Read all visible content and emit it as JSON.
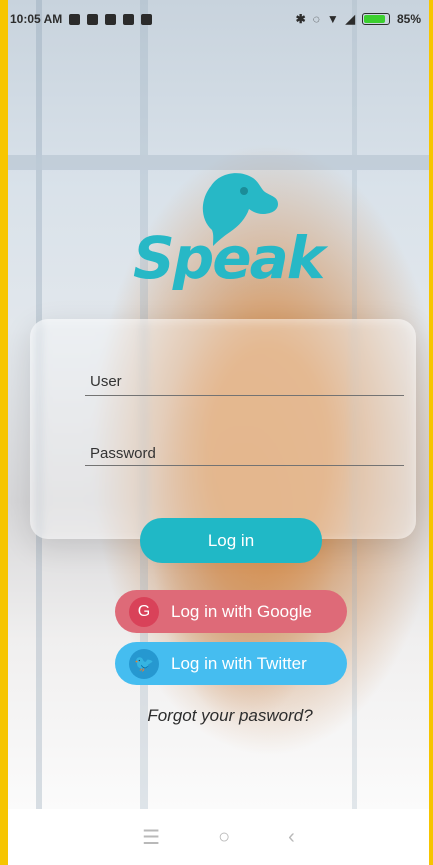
{
  "status": {
    "time": "10:05 AM",
    "left_icons": [
      "screenshot-icon",
      "facebook-icon",
      "linkedin-icon",
      "camera-icon",
      "briefcase-icon"
    ],
    "right_icons": [
      "bluetooth-icon",
      "sync-icon",
      "wifi-icon",
      "signal-icon",
      "battery-icon"
    ],
    "battery": "85%"
  },
  "app": {
    "name": "Speak",
    "brand_color": "#27b8c6"
  },
  "form": {
    "user_placeholder": "User",
    "password_placeholder": "Password"
  },
  "actions": {
    "login": "Log in",
    "google": "Log in with Google",
    "twitter": "Log in with Twitter",
    "forgot": "Forgot your pasword?"
  },
  "navbar": {
    "menu": "☰",
    "home": "○",
    "back": "‹"
  }
}
